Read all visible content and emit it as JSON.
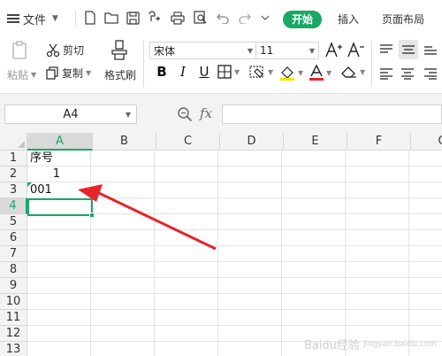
{
  "app": {
    "file_menu_label": "文件",
    "tabs": [
      {
        "label": "开始",
        "active": true
      },
      {
        "label": "插入",
        "active": false
      },
      {
        "label": "页面布局",
        "active": false
      }
    ],
    "accent_color": "#1aa865"
  },
  "ribbon": {
    "paste_label": "粘贴",
    "cut_label": "剪切",
    "copy_label": "复制",
    "format_painter_label": "格式刷",
    "font_name": "宋体",
    "font_size": "11",
    "font_color": "#e8232b",
    "highlight_color": "#f6e300"
  },
  "formula_bar": {
    "name_box": "A4",
    "fx_label": "fx",
    "formula_value": ""
  },
  "sheet": {
    "columns": [
      "A",
      "B",
      "C",
      "D",
      "E",
      "F",
      "G"
    ],
    "selected_column": "A",
    "rows": [
      "1",
      "2",
      "3",
      "4",
      "5",
      "6",
      "7",
      "8",
      "9",
      "10",
      "11",
      "12",
      "13"
    ],
    "selected_row": "4",
    "cells": {
      "A1": "序号",
      "A2": "1",
      "A3": "001",
      "A4": ""
    }
  },
  "watermark": {
    "brand": "Baidu经验",
    "url": "jingyan.baidu.com"
  }
}
